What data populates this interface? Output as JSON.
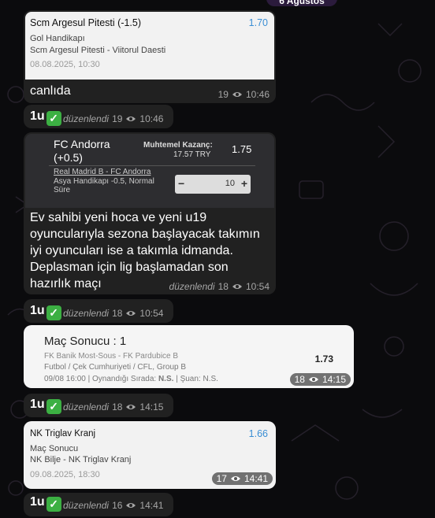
{
  "date_pill": "6 Ağustos",
  "messages": [
    {
      "card": {
        "title": "Scm Argesul Pitesti (-1.5)",
        "odds": "1.70",
        "market": "Gol Handikapı",
        "match": "Scm Argesul Pitesti - Viitorul Daesti",
        "date": "08.08.2025, 10:30"
      },
      "text": "canlıda",
      "views": "19",
      "time": "10:46"
    },
    {
      "text": "1u",
      "edited": "düzenlendi",
      "views": "19",
      "time": "10:46"
    },
    {
      "card": {
        "team": "FC Andorra",
        "handicap": "(+0.5)",
        "payout_label": "Muhtemel Kazanç:",
        "payout_value": "17.57 TRY",
        "odds": "1.75",
        "match": "Real Madrid B - FC Andorra",
        "market": "Asya Handikapı -0.5, Normal Süre",
        "stepper_minus": "−",
        "stepper_value": "10",
        "stepper_plus": "+"
      },
      "text": "Ev sahibi yeni hoca ve yeni u19 oyuncularıyla sezona başlayacak takımın iyi oyuncuları ise a takımla idmanda. Deplasman için lig başlamadan son hazırlık maçı",
      "edited": "düzenlendi",
      "views": "18",
      "time": "10:54"
    },
    {
      "text": "1u",
      "edited": "düzenlendi",
      "views": "18",
      "time": "10:54"
    },
    {
      "card": {
        "title": "Maç Sonucu : 1",
        "match": "FK Banik Most-Sous - FK Pardubice B",
        "league": "Futbol / Çek Cumhuriyeti / CFL, Group B",
        "odds": "1.73",
        "footer_date": "09/08 16:00",
        "footer_played": "Oynandığı Sırada:",
        "footer_played_val": "N.S.",
        "footer_now": "Şuan: N.S."
      },
      "views": "18",
      "time": "14:15"
    },
    {
      "text": "1u",
      "edited": "düzenlendi",
      "views": "18",
      "time": "14:15"
    },
    {
      "card": {
        "title": "NK Triglav Kranj",
        "odds": "1.66",
        "market": "Maç Sonucu",
        "match": "NK Bilje - NK Triglav Kranj",
        "date": "09.08.2025, 18:30"
      },
      "views": "17",
      "time": "14:41"
    },
    {
      "text": "1u",
      "edited": "düzenlendi",
      "views": "16",
      "time": "14:41"
    }
  ]
}
